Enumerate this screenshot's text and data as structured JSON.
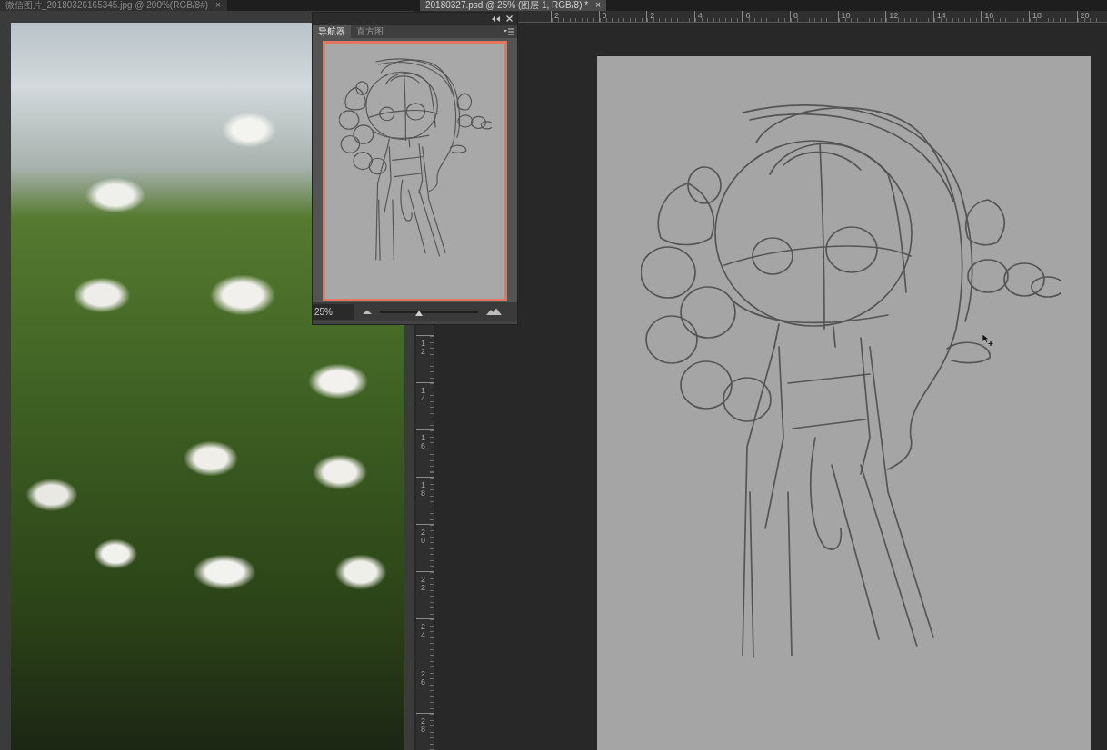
{
  "documents": [
    {
      "title": "微信图片_20180326165345.jpg @ 200%(RGB/8#)",
      "close": "×",
      "selected": false
    },
    {
      "title": "20180327.psd @ 25% (图层 1, RGB/8) *",
      "close": "×",
      "selected": true
    }
  ],
  "rulers": {
    "horizontal": [
      "2",
      "0",
      "2",
      "4",
      "6",
      "8",
      "10",
      "12",
      "14",
      "16",
      "18",
      "20"
    ],
    "vertical": [
      "12",
      "14",
      "16",
      "18",
      "20",
      "22",
      "24",
      "26",
      "28"
    ]
  },
  "navigator": {
    "tabs": [
      {
        "label": "导航器",
        "selected": true
      },
      {
        "label": "直方图",
        "selected": false
      }
    ],
    "zoom": "25%",
    "zoom_slider": {
      "level": 0.4
    }
  }
}
